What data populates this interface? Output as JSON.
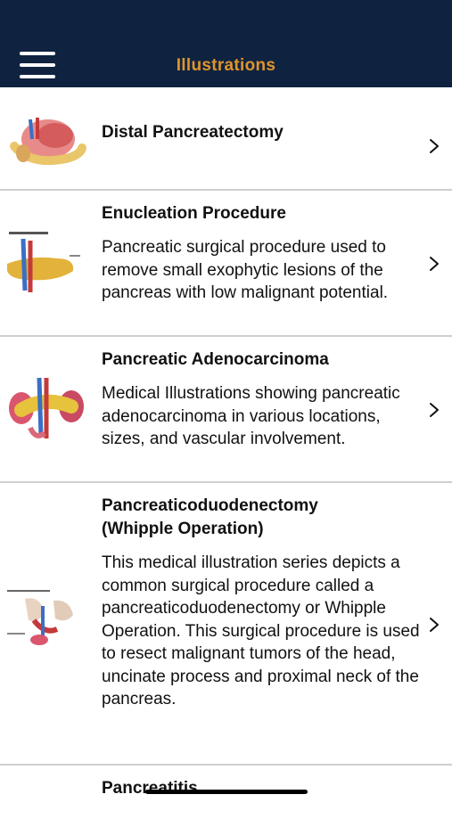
{
  "header": {
    "title": "Illustrations",
    "menu_icon": "hamburger-menu-icon",
    "background": "#0f2340",
    "title_color": "#e0942c"
  },
  "items": [
    {
      "title": "Distal Pancreatectomy",
      "description": "",
      "thumbnail_icon": "distal-pancreatectomy-illustration-icon"
    },
    {
      "title": "Enucleation Procedure",
      "description": "Pancreatic surgical procedure used to remove small exophytic lesions of the pancreas with low malignant potential.",
      "thumbnail_icon": "enucleation-illustration-icon"
    },
    {
      "title": "Pancreatic Adenocarcinoma",
      "description": "Medical Illustrations showing pancreatic adenocarcinoma in various locations, sizes, and vascular involvement.",
      "thumbnail_icon": "adenocarcinoma-illustration-icon"
    },
    {
      "title": "Pancreaticoduodenectomy (Whipple Operation)",
      "description": "This medical illustration series depicts a common surgical procedure called a pancreaticoduodenectomy or Whipple Operation. This surgical procedure is used to resect malignant tumors of the head, uncinate process and proximal neck of the pancreas.",
      "thumbnail_icon": "whipple-illustration-icon"
    },
    {
      "title": "Pancreatitis",
      "description": "",
      "thumbnail_icon": ""
    }
  ]
}
